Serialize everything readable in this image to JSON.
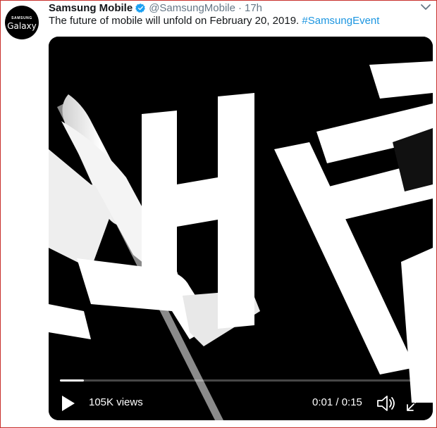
{
  "avatar": {
    "brand": "SAMSUNG",
    "product": "Galaxy"
  },
  "tweet": {
    "name": "Samsung Mobile",
    "handle": "@SamsungMobile",
    "separator": "·",
    "time": "17h",
    "text": "The future of mobile will unfold on February 20, 2019.",
    "hashtag": "#SamsungEvent"
  },
  "video": {
    "views": "105K views",
    "time_display": "0:01 / 0:15",
    "progress": 0.067
  },
  "icons": {
    "verified": "verified-badge-icon",
    "menu": "chevron-down-icon",
    "play": "play-icon",
    "volume": "volume-muted-icon",
    "fullscreen": "fullscreen-icon"
  },
  "colors": {
    "link": "#1b95e0",
    "verified": "#1da1f2",
    "muted_text": "#657786",
    "frame_border": "#c9302c"
  }
}
